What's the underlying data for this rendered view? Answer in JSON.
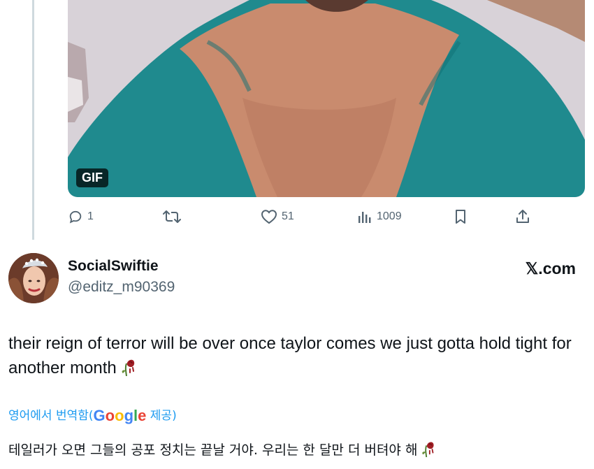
{
  "media": {
    "badge": "GIF"
  },
  "actions": {
    "reply_count": "1",
    "like_count": "51",
    "views_count": "1009"
  },
  "author": {
    "name": "SocialSwiftie",
    "handle": "@editz_m90369"
  },
  "source_label": "𝕏.com",
  "tweet": {
    "text": "their reign of terror will be over once taylor comes we just gotta hold tight for another month"
  },
  "translation": {
    "prefix": "영어에서 번역함(",
    "google_letters": [
      "G",
      "o",
      "o",
      "g",
      "l",
      "e"
    ],
    "google_colors": [
      "#4285F4",
      "#EA4335",
      "#FBBC05",
      "#4285F4",
      "#34A853",
      "#EA4335"
    ],
    "suffix": " 제공)",
    "text": "테일러가 오면 그들의 공포 정치는 끝날 거야. 우리는 한 달만 더 버텨야 해"
  },
  "colors": {
    "accent": "#1d9bf0",
    "muted": "#536471"
  }
}
